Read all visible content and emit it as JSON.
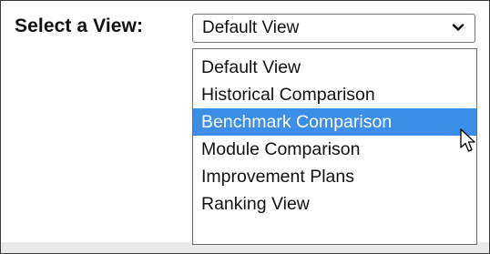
{
  "view_selector": {
    "label": "Select a View:",
    "selected_value": "Default View",
    "highlighted_option": "Benchmark Comparison",
    "options": [
      "Default View",
      "Historical Comparison",
      "Benchmark Comparison",
      "Module Comparison",
      "Improvement Plans",
      "Ranking View"
    ]
  },
  "icons": {
    "dropdown_toggle": "chevron-down-icon",
    "pointer": "mouse-cursor-icon"
  },
  "colors": {
    "highlight": "#3c8ee8",
    "text": "#111111",
    "border": "#3a3a3a"
  }
}
